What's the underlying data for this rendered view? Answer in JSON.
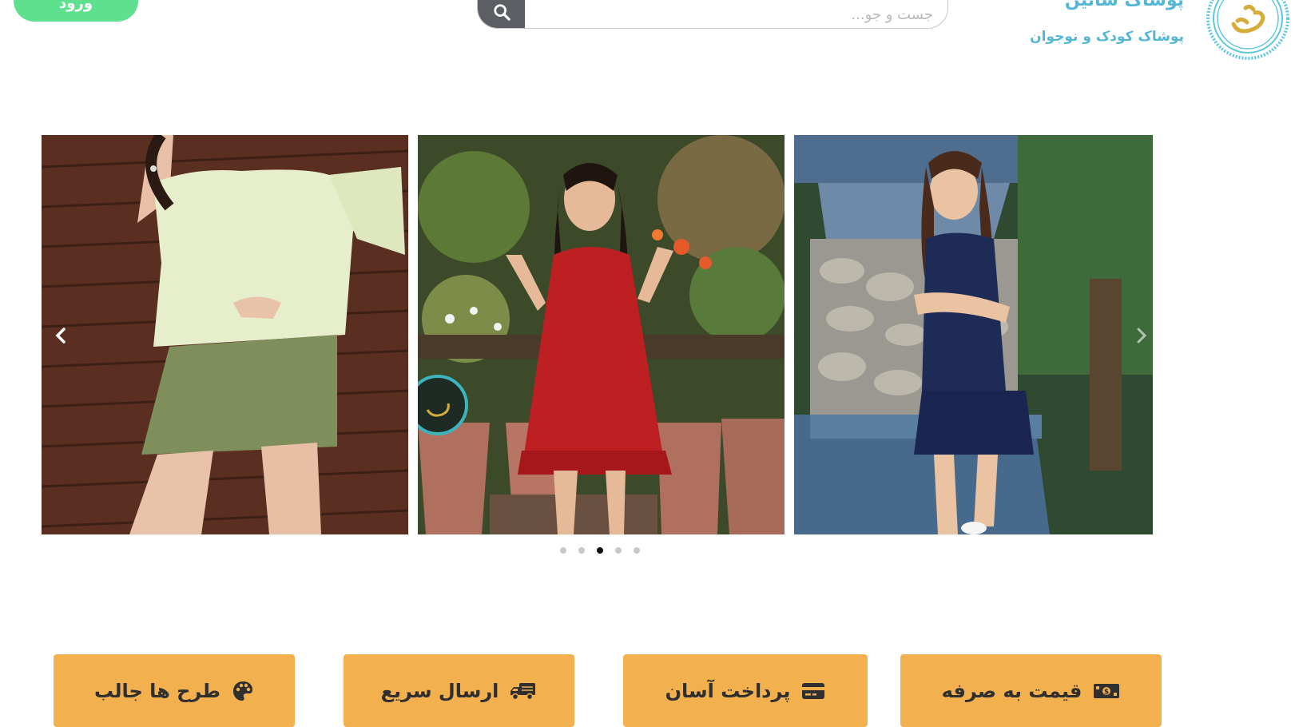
{
  "header": {
    "login_label": "ورود",
    "search_placeholder": "جست و جو...",
    "brand_name": "پوشاک ساتین",
    "brand_tagline": "پوشاک کودک و نوجوان"
  },
  "slider": {
    "slides": [
      {
        "icon": "image-girl-green-top"
      },
      {
        "icon": "image-girl-red-dress"
      },
      {
        "icon": "image-girl-navy-outfit"
      }
    ],
    "dot_count": 5,
    "active_dot": 2
  },
  "features": [
    {
      "label": "طرح ها جالب",
      "icon": "palette-icon"
    },
    {
      "label": "ارسال سریع",
      "icon": "truck-icon"
    },
    {
      "label": "پرداخت آسان",
      "icon": "credit-card-icon"
    },
    {
      "label": "قیمت به صرفه",
      "icon": "money-bill-icon"
    }
  ],
  "colors": {
    "accent_green": "#5ee08f",
    "brand_blue": "#56b6d8",
    "feature_orange": "#f3b04f"
  }
}
